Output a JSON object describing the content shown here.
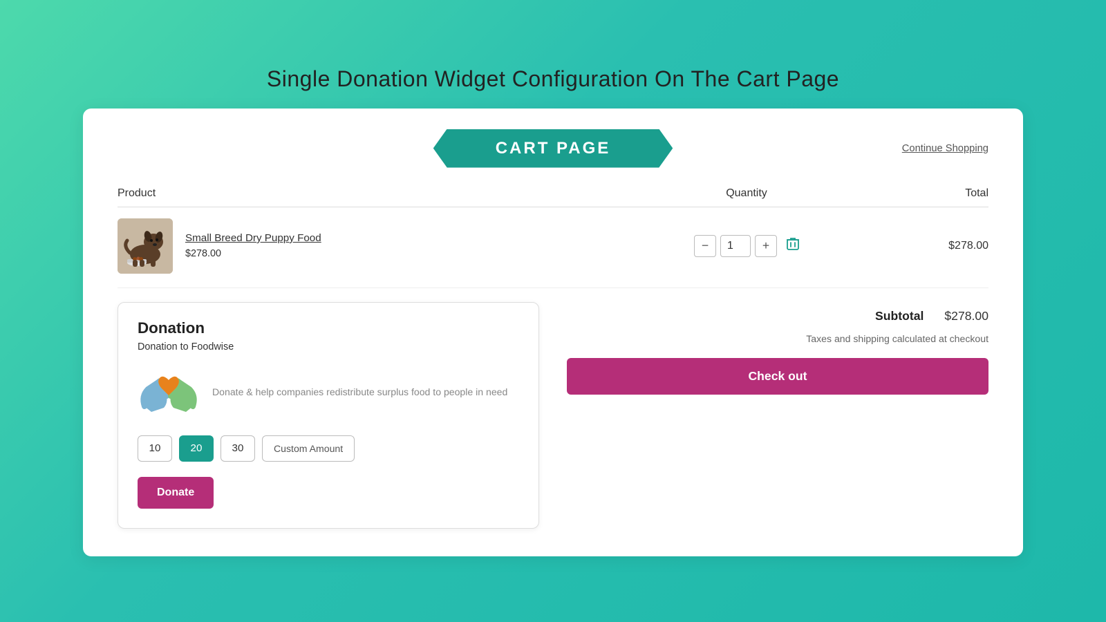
{
  "page": {
    "title": "Single Donation Widget Configuration On The Cart Page"
  },
  "header": {
    "cart_label": "CART PAGE",
    "continue_shopping": "Continue Shopping"
  },
  "table": {
    "col_product": "Product",
    "col_quantity": "Quantity",
    "col_total": "Total"
  },
  "product": {
    "name": "Small Breed Dry Puppy Food",
    "price": "$278.00",
    "quantity": 1,
    "total": "$278.00"
  },
  "donation": {
    "title": "Donation",
    "subtitle": "Donation to Foodwise",
    "description": "Donate & help companies redistribute surplus food to people in need",
    "amounts": [
      "10",
      "20",
      "30"
    ],
    "active_amount": "20",
    "custom_label": "Custom Amount",
    "donate_btn": "Donate"
  },
  "summary": {
    "subtotal_label": "Subtotal",
    "subtotal_value": "$278.00",
    "tax_note": "Taxes and shipping calculated at checkout",
    "checkout_label": "Check out"
  },
  "colors": {
    "teal": "#1a9e8e",
    "purple": "#b52e78"
  }
}
